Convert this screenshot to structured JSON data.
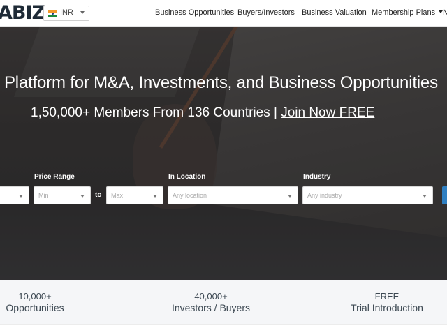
{
  "brand": {
    "logo_text": "ABIZ"
  },
  "currency": {
    "code": "INR",
    "flag_icon": "india-flag-icon"
  },
  "nav": {
    "items": [
      {
        "label": "Business Opportunities"
      },
      {
        "label": "Buyers/Investors"
      },
      {
        "label": "Business Valuation"
      },
      {
        "label": "Membership Plans"
      },
      {
        "label": "N"
      }
    ]
  },
  "hero": {
    "title": "Platform for M&A, Investments, and Business Opportunities",
    "subtitle": "1,50,000+ Members From 136 Countries | ",
    "join_label": "Join Now FREE"
  },
  "filters": {
    "price_range_label": "Price Range",
    "min_placeholder": "Min",
    "to_label": "to",
    "max_placeholder": "Max",
    "location_label": "In Location",
    "location_placeholder": "Any location",
    "industry_label": "Industry",
    "industry_placeholder": "Any industry"
  },
  "stats": [
    {
      "number": "10,000+",
      "label": "Opportunities"
    },
    {
      "number": "40,000+",
      "label": "Investors / Buyers"
    },
    {
      "number": "FREE",
      "label": "Trial Introduction"
    }
  ],
  "colors": {
    "accent": "#2f7fc1",
    "hero_overlay": "#3a3735",
    "stats_bg": "#f5f6f8"
  }
}
